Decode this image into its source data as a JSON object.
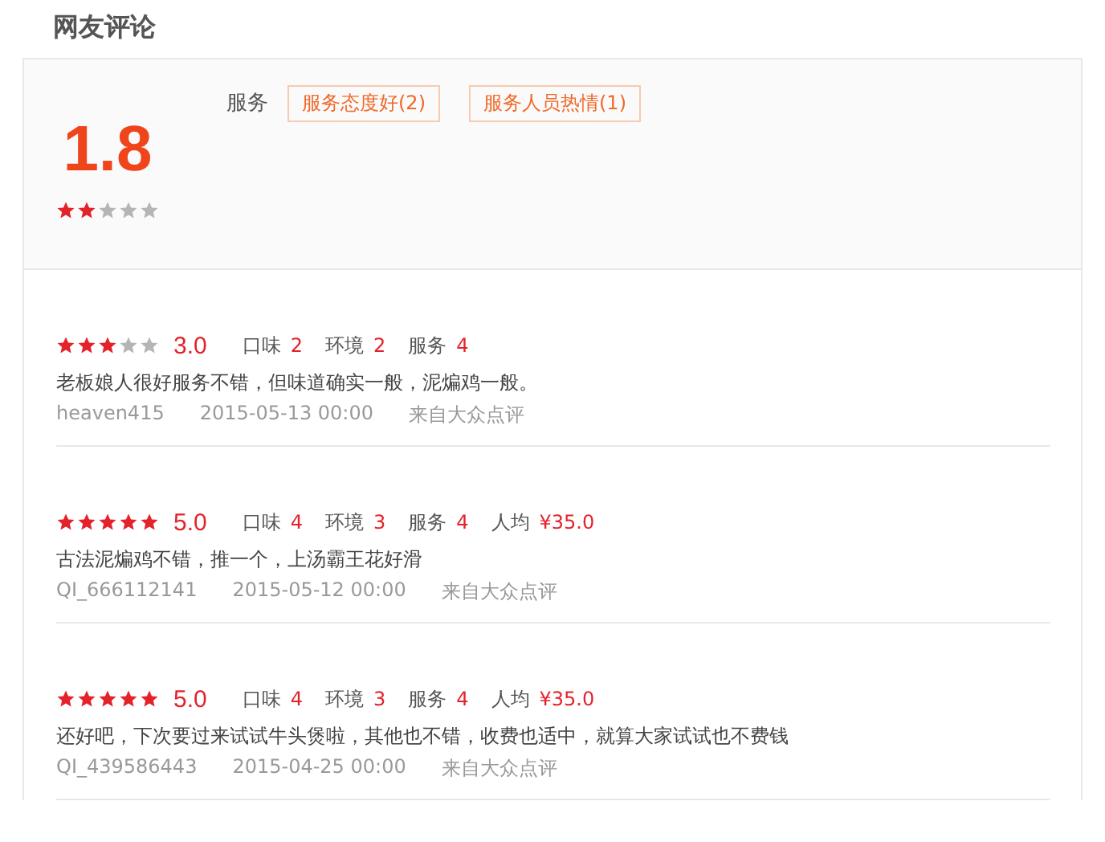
{
  "title": "网友评论",
  "summary": {
    "score": "1.8",
    "stars": 2,
    "tag_group": "服务",
    "tags": [
      "服务态度好(2)",
      "服务人员热情(1)"
    ]
  },
  "reviews": [
    {
      "stars": 3,
      "score": "3.0",
      "ratings": [
        {
          "label": "口味",
          "value": "2"
        },
        {
          "label": "环境",
          "value": "2"
        },
        {
          "label": "服务",
          "value": "4"
        }
      ],
      "text": "老板娘人很好服务不错，但味道确实一般，泥煸鸡一般。",
      "user": "heaven415",
      "date": "2015-05-13 00:00",
      "source": "来自大众点评"
    },
    {
      "stars": 5,
      "score": "5.0",
      "ratings": [
        {
          "label": "口味",
          "value": "4"
        },
        {
          "label": "环境",
          "value": "3"
        },
        {
          "label": "服务",
          "value": "4"
        },
        {
          "label": "人均",
          "value": "¥35.0"
        }
      ],
      "text": "古法泥煸鸡不错，推一个，上汤霸王花好滑",
      "user": "QI_666112141",
      "date": "2015-05-12 00:00",
      "source": "来自大众点评"
    },
    {
      "stars": 5,
      "score": "5.0",
      "ratings": [
        {
          "label": "口味",
          "value": "4"
        },
        {
          "label": "环境",
          "value": "3"
        },
        {
          "label": "服务",
          "value": "4"
        },
        {
          "label": "人均",
          "value": "¥35.0"
        }
      ],
      "text": "还好吧，下次要过来试试牛头煲啦，其他也不错，收费也适中，就算大家试试也不费钱",
      "user": "QI_439586443",
      "date": "2015-04-25 00:00",
      "source": "来自大众点评"
    }
  ]
}
